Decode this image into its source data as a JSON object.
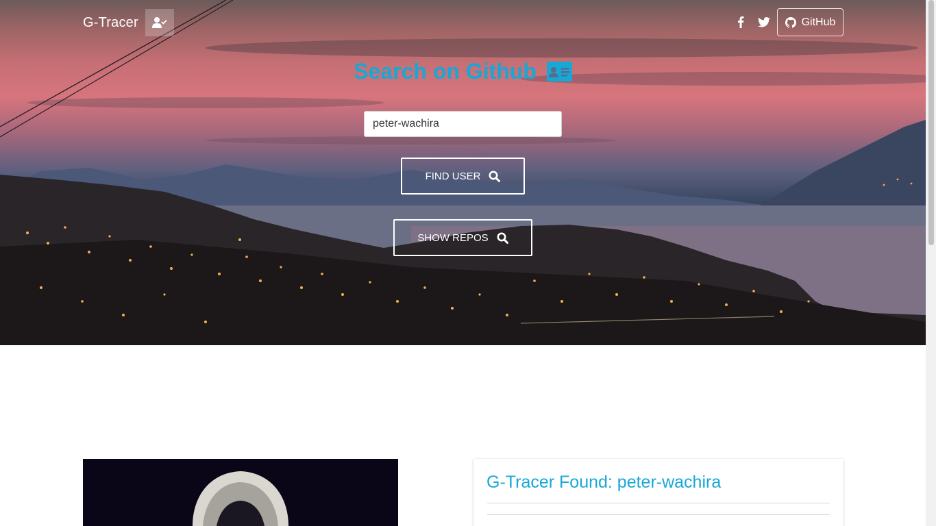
{
  "navbar": {
    "brand": "G-Tracer",
    "user_icon": "user-check-icon",
    "facebook_icon": "facebook-icon",
    "twitter_icon": "twitter-icon",
    "github_label": "GitHub",
    "github_icon": "github-icon"
  },
  "hero": {
    "heading": "Search on Github",
    "heading_icon": "id-card-icon",
    "search": {
      "value": "peter-wachira"
    },
    "find_user_label": "FIND USER",
    "show_repos_label": "SHOW REPOS",
    "button_icon": "search-icon"
  },
  "result": {
    "title": "G-Tracer Found: peter-wachira"
  },
  "colors": {
    "accent": "#17a8d6",
    "white": "#ffffff",
    "divider": "#d6d6d6"
  }
}
